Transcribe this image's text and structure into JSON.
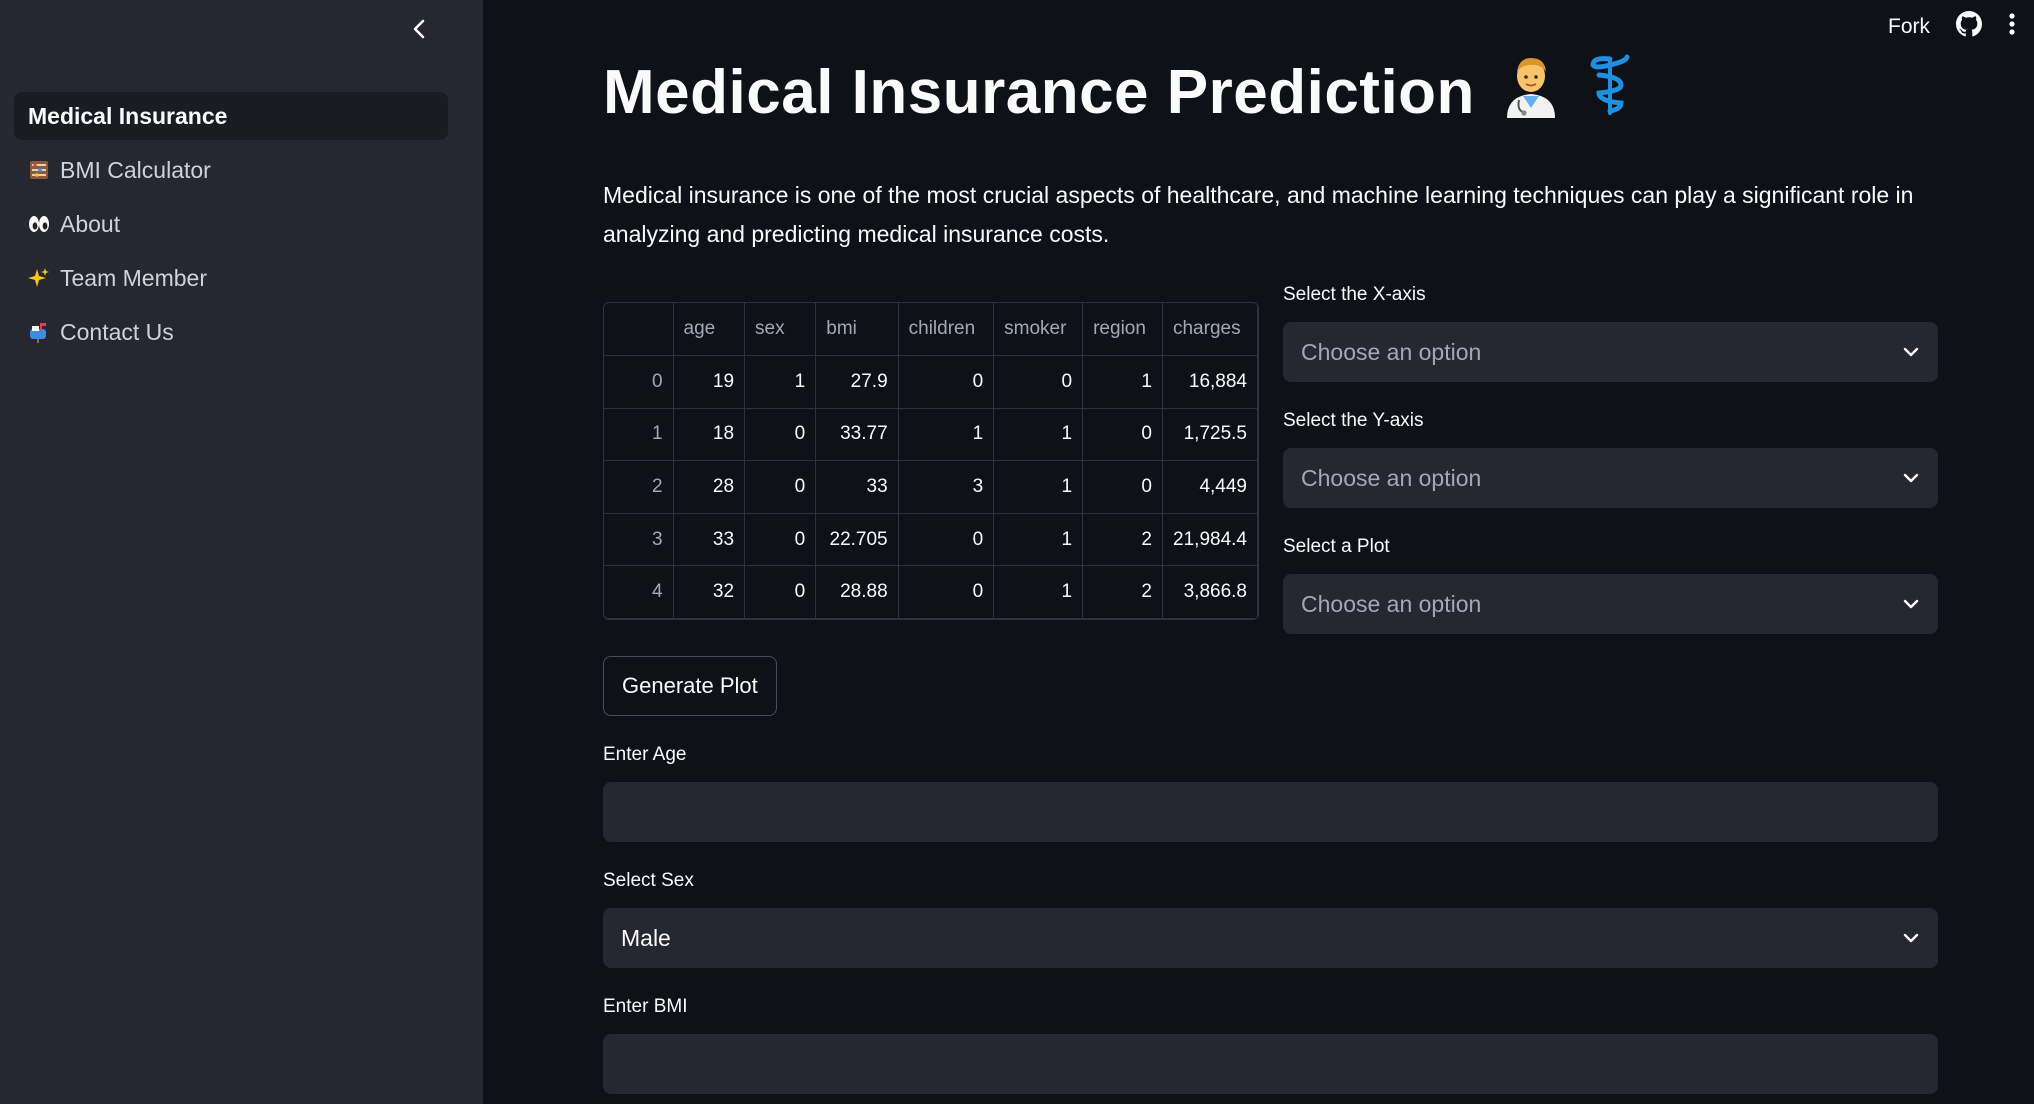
{
  "sidebar": {
    "items": [
      {
        "label": "Medical Insurance",
        "icon": ""
      },
      {
        "label": "BMI Calculator",
        "icon": "abacus-icon"
      },
      {
        "label": "About",
        "icon": "eyes-icon"
      },
      {
        "label": "Team Member",
        "icon": "sparkles-icon"
      },
      {
        "label": "Contact Us",
        "icon": "mailbox-icon"
      }
    ]
  },
  "topbar": {
    "fork_label": "Fork"
  },
  "page": {
    "title": "Medical Insurance Prediction",
    "description": "Medical insurance is one of the most crucial aspects of healthcare, and machine learning techniques can play a significant role in analyzing and predicting medical insurance costs."
  },
  "table": {
    "columns": [
      "",
      "age",
      "sex",
      "bmi",
      "children",
      "smoker",
      "region",
      "charges"
    ],
    "rows": [
      [
        "0",
        "19",
        "1",
        "27.9",
        "0",
        "0",
        "1",
        "16,884"
      ],
      [
        "1",
        "18",
        "0",
        "33.77",
        "1",
        "1",
        "0",
        "1,725.5"
      ],
      [
        "2",
        "28",
        "0",
        "33",
        "3",
        "1",
        "0",
        "4,449"
      ],
      [
        "3",
        "33",
        "0",
        "22.705",
        "0",
        "1",
        "2",
        "21,984.4"
      ],
      [
        "4",
        "32",
        "0",
        "28.88",
        "0",
        "1",
        "2",
        "3,866.8"
      ]
    ]
  },
  "selects": [
    {
      "label": "Select the X-axis",
      "value": "Choose an option"
    },
    {
      "label": "Select the Y-axis",
      "value": "Choose an option"
    },
    {
      "label": "Select a Plot",
      "value": "Choose an option"
    }
  ],
  "generate_label": "Generate Plot",
  "form": {
    "age_label": "Enter Age",
    "age_value": "",
    "sex_label": "Select Sex",
    "sex_value": "Male",
    "bmi_label": "Enter BMI",
    "bmi_value": ""
  },
  "colors": {
    "background": "#0e1117",
    "sidebar": "#262730",
    "input": "#262730"
  }
}
